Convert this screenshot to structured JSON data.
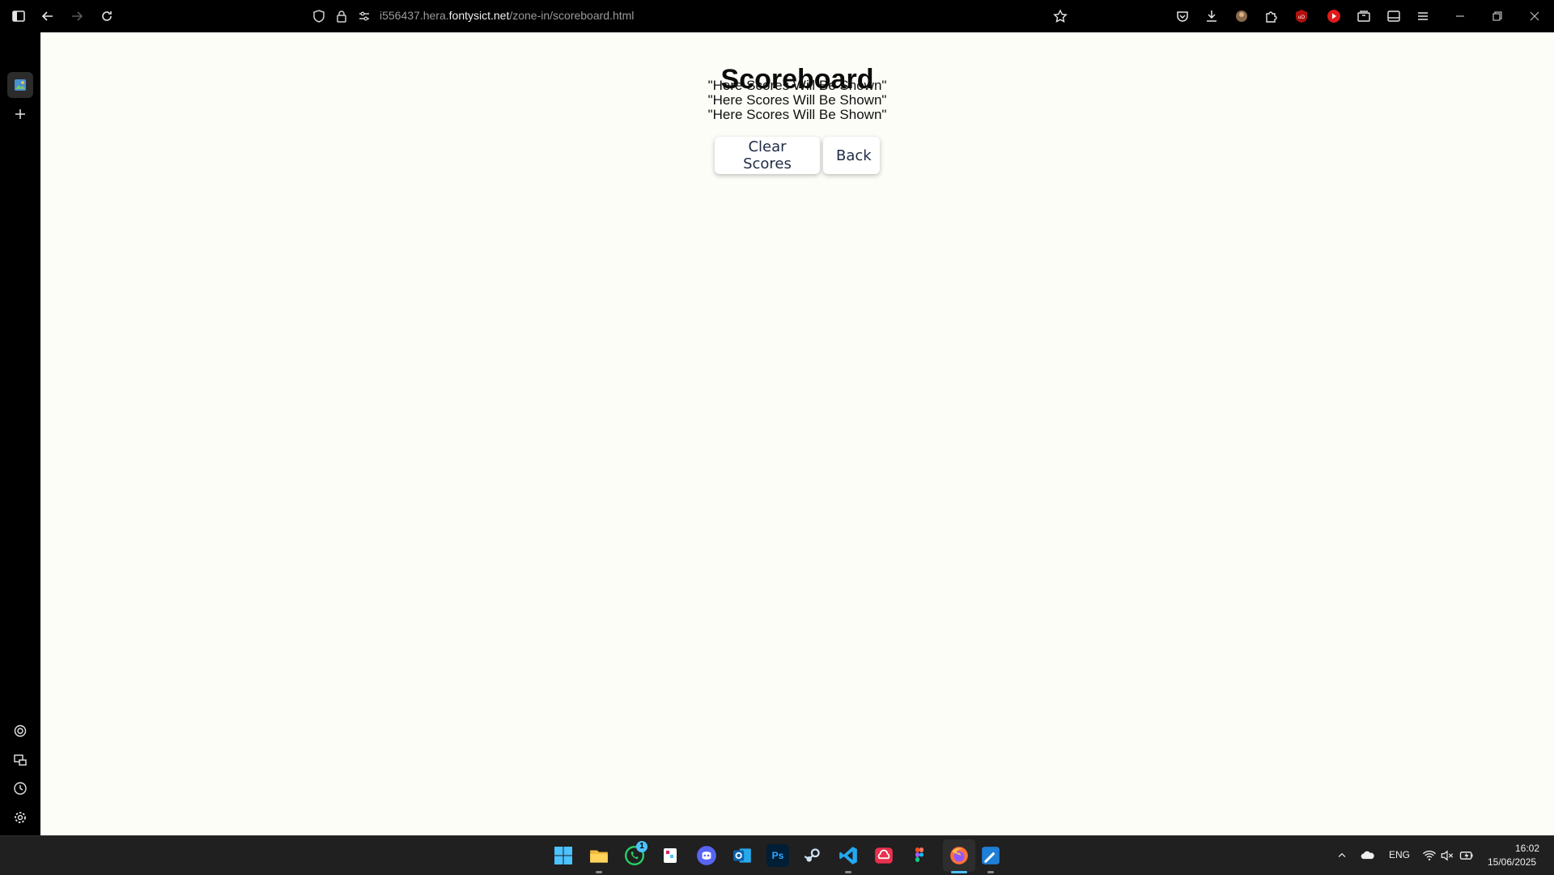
{
  "browser": {
    "url_prefix": "i556437.hera.",
    "url_host": "fontysict.net",
    "url_path": "/zone-in/scoreboard.html"
  },
  "page": {
    "title": "Scoreboard",
    "score_lines": [
      "\"Here Scores Will Be Shown\"",
      "\"Here Scores Will Be Shown\"",
      "\"Here Scores Will Be Shown\""
    ],
    "clear_label": "Clear Scores",
    "back_label": "Back"
  },
  "taskbar": {
    "language": "ENG",
    "time": "16:02",
    "date": "15/06/2025",
    "whatsapp_badge": "1",
    "ps_label": "Ps"
  },
  "colors": {
    "page_bg": "#fdfdf8",
    "button_text": "#1f2b45",
    "chrome_bg": "#000000",
    "taskbar_bg": "#202020"
  }
}
